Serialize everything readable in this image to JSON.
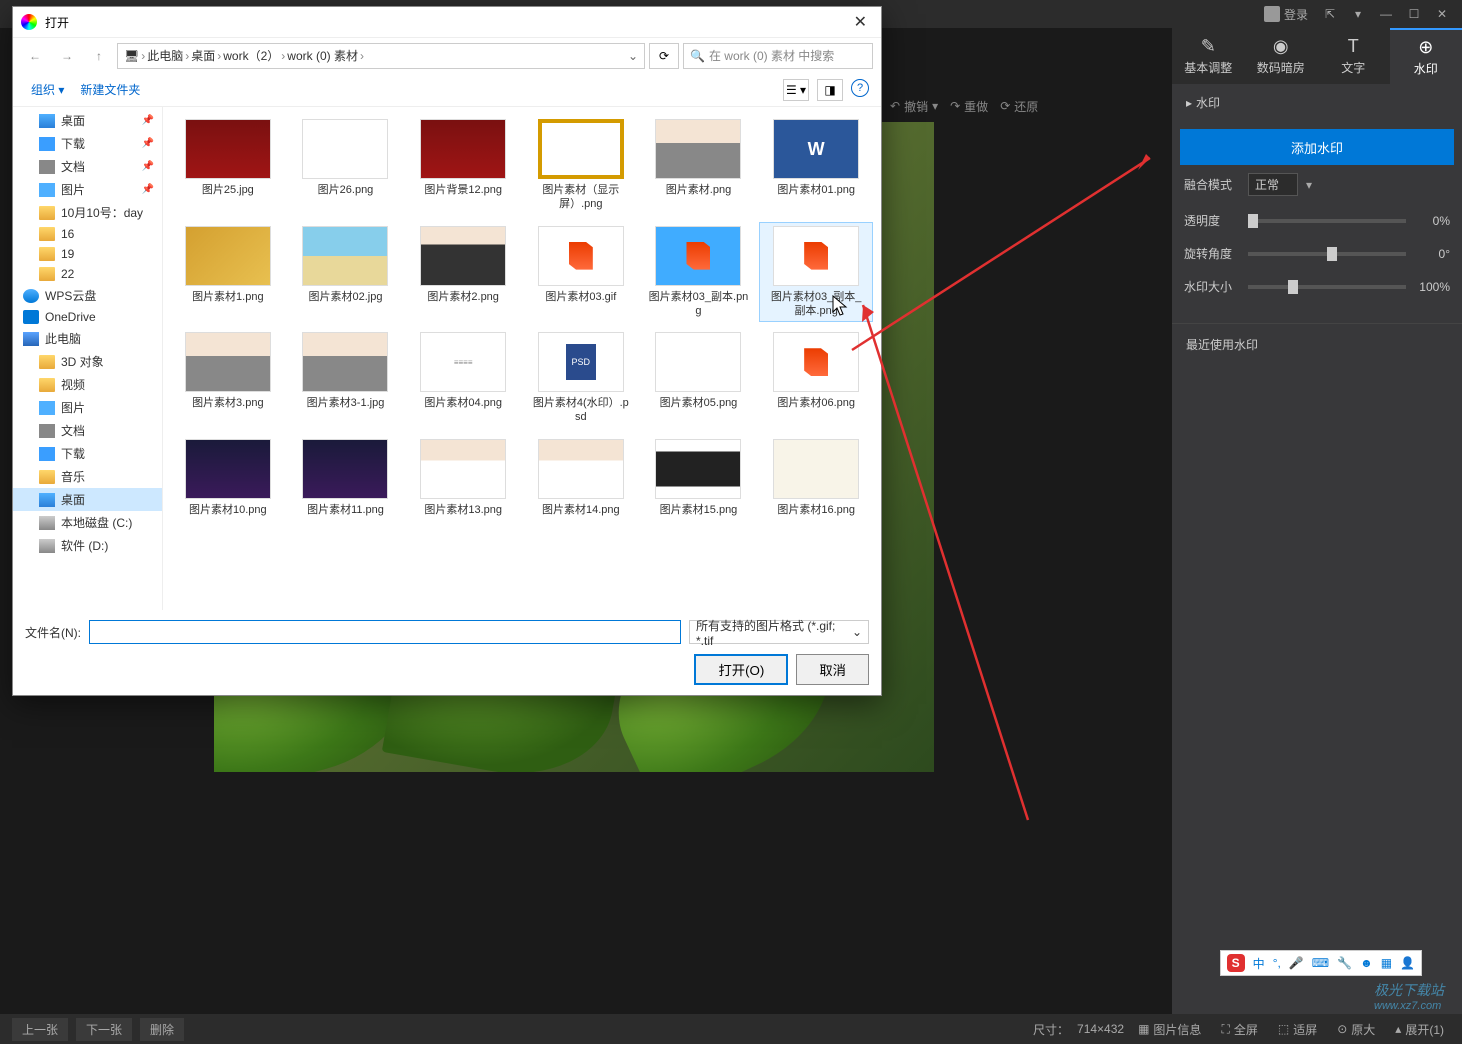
{
  "topbar": {
    "login": "登录"
  },
  "tabs": {
    "basic": "基本调整",
    "darkroom": "数码暗房",
    "text": "文字",
    "watermark": "水印"
  },
  "panel": {
    "title": "水印",
    "add_btn": "添加水印",
    "blend_label": "融合模式",
    "blend_value": "正常",
    "opacity_label": "透明度",
    "opacity_value": "0%",
    "rotate_label": "旋转角度",
    "rotate_value": "0°",
    "size_label": "水印大小",
    "size_value": "100%",
    "recent_label": "最近使用水印"
  },
  "midtoolbar": {
    "undo": "撤销",
    "redo": "重做",
    "restore": "还原"
  },
  "bottombar": {
    "prev": "上一张",
    "next": "下一张",
    "delete": "删除",
    "size": "尺寸：",
    "size_val": "714×432",
    "info": "图片信息",
    "fullscreen": "全屏",
    "fit": "适屏",
    "original": "原大",
    "expand": "展开(1)"
  },
  "dialog": {
    "title": "打开",
    "breadcrumb": [
      "此电脑",
      "桌面",
      "work（2）",
      "work (0) 素材"
    ],
    "search_placeholder": "在 work (0) 素材 中搜索",
    "organize": "组织",
    "new_folder": "新建文件夹",
    "filename_label": "文件名(N):",
    "filename_value": "",
    "filetype": "所有支持的图片格式 (*.gif; *.tif",
    "open_btn": "打开(O)",
    "cancel_btn": "取消"
  },
  "sidebar": [
    {
      "label": "桌面",
      "type": "desktop",
      "pin": true
    },
    {
      "label": "下载",
      "type": "download",
      "pin": true
    },
    {
      "label": "文档",
      "type": "doc",
      "pin": true
    },
    {
      "label": "图片",
      "type": "pic",
      "pin": true
    },
    {
      "label": "10月10号：day",
      "type": "folder"
    },
    {
      "label": "16",
      "type": "folder"
    },
    {
      "label": "19",
      "type": "folder"
    },
    {
      "label": "22",
      "type": "folder"
    },
    {
      "label": "WPS云盘",
      "type": "wps",
      "top": true
    },
    {
      "label": "OneDrive",
      "type": "onedrive",
      "top": true
    },
    {
      "label": "此电脑",
      "type": "pc",
      "top": true
    },
    {
      "label": "3D 对象",
      "type": "folder"
    },
    {
      "label": "视频",
      "type": "folder"
    },
    {
      "label": "图片",
      "type": "pic"
    },
    {
      "label": "文档",
      "type": "doc"
    },
    {
      "label": "下载",
      "type": "download"
    },
    {
      "label": "音乐",
      "type": "folder"
    },
    {
      "label": "桌面",
      "type": "desktop",
      "selected": true
    },
    {
      "label": "本地磁盘 (C:)",
      "type": "drive"
    },
    {
      "label": "软件 (D:)",
      "type": "drive"
    }
  ],
  "files": [
    {
      "name": "图片25.jpg",
      "thumb": "red"
    },
    {
      "name": "图片26.png",
      "thumb": "white"
    },
    {
      "name": "图片背景12.png",
      "thumb": "red"
    },
    {
      "name": "图片素材（显示屏）.png",
      "thumb": "frame"
    },
    {
      "name": "图片素材.png",
      "thumb": "person"
    },
    {
      "name": "图片素材01.png",
      "thumb": "word"
    },
    {
      "name": "图片素材1.png",
      "thumb": "leaf"
    },
    {
      "name": "图片素材02.jpg",
      "thumb": "beach"
    },
    {
      "name": "图片素材2.png",
      "thumb": "face"
    },
    {
      "name": "图片素材03.gif",
      "thumb": "office"
    },
    {
      "name": "图片素材03_副本.png",
      "thumb": "office-blue"
    },
    {
      "name": "图片素材03_副本_副本.png",
      "thumb": "office",
      "hover": true
    },
    {
      "name": "图片素材3.png",
      "thumb": "person"
    },
    {
      "name": "图片素材3-1.jpg",
      "thumb": "person"
    },
    {
      "name": "图片素材04.png",
      "thumb": "doc"
    },
    {
      "name": "图片素材4(水印）.psd",
      "thumb": "psd"
    },
    {
      "name": "图片素材05.png",
      "thumb": "axis"
    },
    {
      "name": "图片素材06.png",
      "thumb": "office"
    },
    {
      "name": "图片素材10.png",
      "thumb": "night"
    },
    {
      "name": "图片素材11.png",
      "thumb": "night"
    },
    {
      "name": "图片素材13.png",
      "thumb": "model"
    },
    {
      "name": "图片素材14.png",
      "thumb": "model"
    },
    {
      "name": "图片素材15.png",
      "thumb": "suit"
    },
    {
      "name": "图片素材16.png",
      "thumb": "paper"
    }
  ],
  "ime": {
    "label": "中"
  },
  "logo": {
    "text": "极光下载站",
    "url": "www.xz7.com"
  }
}
